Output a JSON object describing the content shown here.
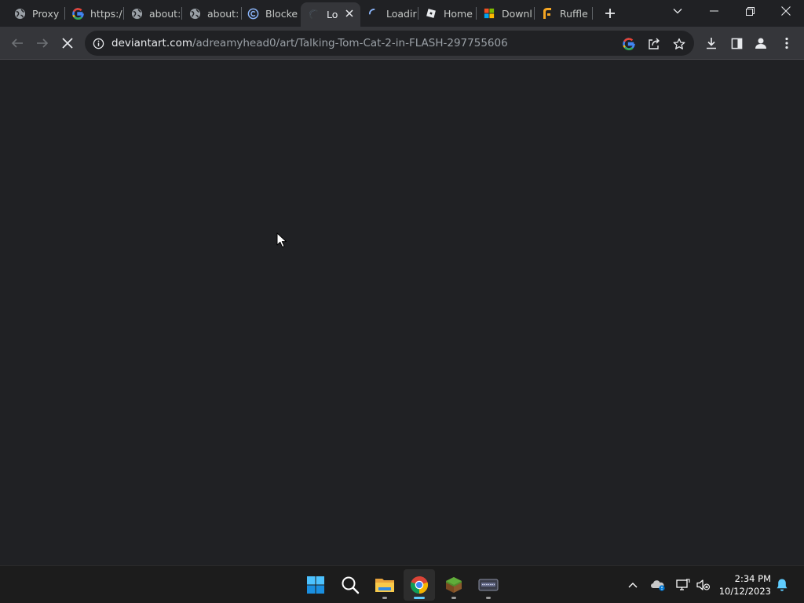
{
  "browser": {
    "tabs": [
      {
        "title": "Proxy",
        "favicon": "globe-icon"
      },
      {
        "title": "https:/",
        "favicon": "google-icon"
      },
      {
        "title": "about:",
        "favicon": "globe-icon"
      },
      {
        "title": "about:",
        "favicon": "globe-icon"
      },
      {
        "title": "Blocke",
        "favicon": "proxy-c-icon"
      },
      {
        "title": "Lo",
        "favicon": "loading-spinner-icon",
        "active": true
      },
      {
        "title": "Loadir",
        "favicon": "loading-spinner-icon"
      },
      {
        "title": "Home",
        "favicon": "roblox-icon"
      },
      {
        "title": "Downl",
        "favicon": "microsoft-icon"
      },
      {
        "title": "Ruffle",
        "favicon": "ruffle-icon"
      }
    ],
    "address": {
      "host": "deviantart.com",
      "path": "/adreamyhead0/art/Talking-Tom-Cat-2-in-FLASH-297755606"
    }
  },
  "taskbar": {
    "apps": [
      "start-windows-icon",
      "search-icon",
      "file-explorer-icon",
      "chrome-icon",
      "minecraft-icon",
      "terminal-app-icon"
    ],
    "time": "2:34 PM",
    "date": "10/12/2023"
  },
  "colors": {
    "page_background": "#202124",
    "toolbar": "#35363a",
    "taskbar": "#1c1c1c",
    "accent": "#60cdff"
  }
}
